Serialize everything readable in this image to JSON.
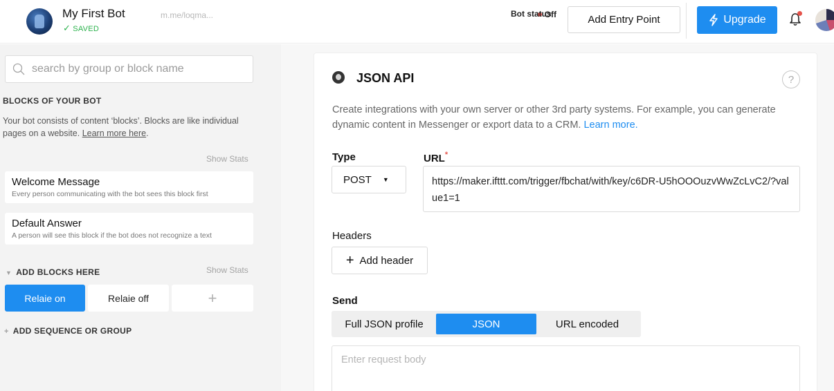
{
  "header": {
    "bot_name": "My First Bot",
    "saved_status": "SAVED",
    "bot_link": "m.me/loqma...",
    "bot_status_label": "Bot status",
    "bot_status_value": "Off",
    "add_entry_point": "Add Entry Point",
    "upgrade": "Upgrade"
  },
  "sidebar": {
    "search_placeholder": "search by group or block name",
    "blocks_title": "BLOCKS OF YOUR BOT",
    "blocks_desc": "Your bot consists of content ‘blocks’. Blocks are like individual pages on a website.",
    "learn_more": "Learn more here",
    "show_stats": "Show Stats",
    "blocks": [
      {
        "title": "Welcome Message",
        "subtitle": "Every person communicating with the bot sees this block first"
      },
      {
        "title": "Default Answer",
        "subtitle": "A person will see this block if the bot does not recognize a text"
      }
    ],
    "add_blocks_title": "ADD BLOCKS HERE",
    "pills": [
      {
        "label": "Relaie on"
      },
      {
        "label": "Relaie off"
      },
      {
        "label": "+"
      }
    ],
    "add_sequence": "ADD SEQUENCE OR GROUP"
  },
  "main": {
    "title": "JSON API",
    "help": "?",
    "intro": "Create integrations with your own server or other 3rd party systems. For example, you can generate dynamic content in Messenger or export data to a CRM.",
    "intro_link": "Learn more.",
    "type_label": "Type",
    "type_value": "POST",
    "url_label": "URL",
    "url_required": "*",
    "url_value": "https://maker.ifttt.com/trigger/fbchat/with/key/c6DR-U5hOOOuzvWwZcLvC2/?value1=1",
    "headers_label": "Headers",
    "add_header": "Add header",
    "send_label": "Send",
    "send_options": [
      "Full JSON profile",
      "JSON",
      "URL encoded"
    ],
    "body_placeholder": "Enter request body"
  },
  "colors": {
    "accent": "#1e8df0",
    "saved": "#2bb24c",
    "status_off": "#e5534b"
  }
}
